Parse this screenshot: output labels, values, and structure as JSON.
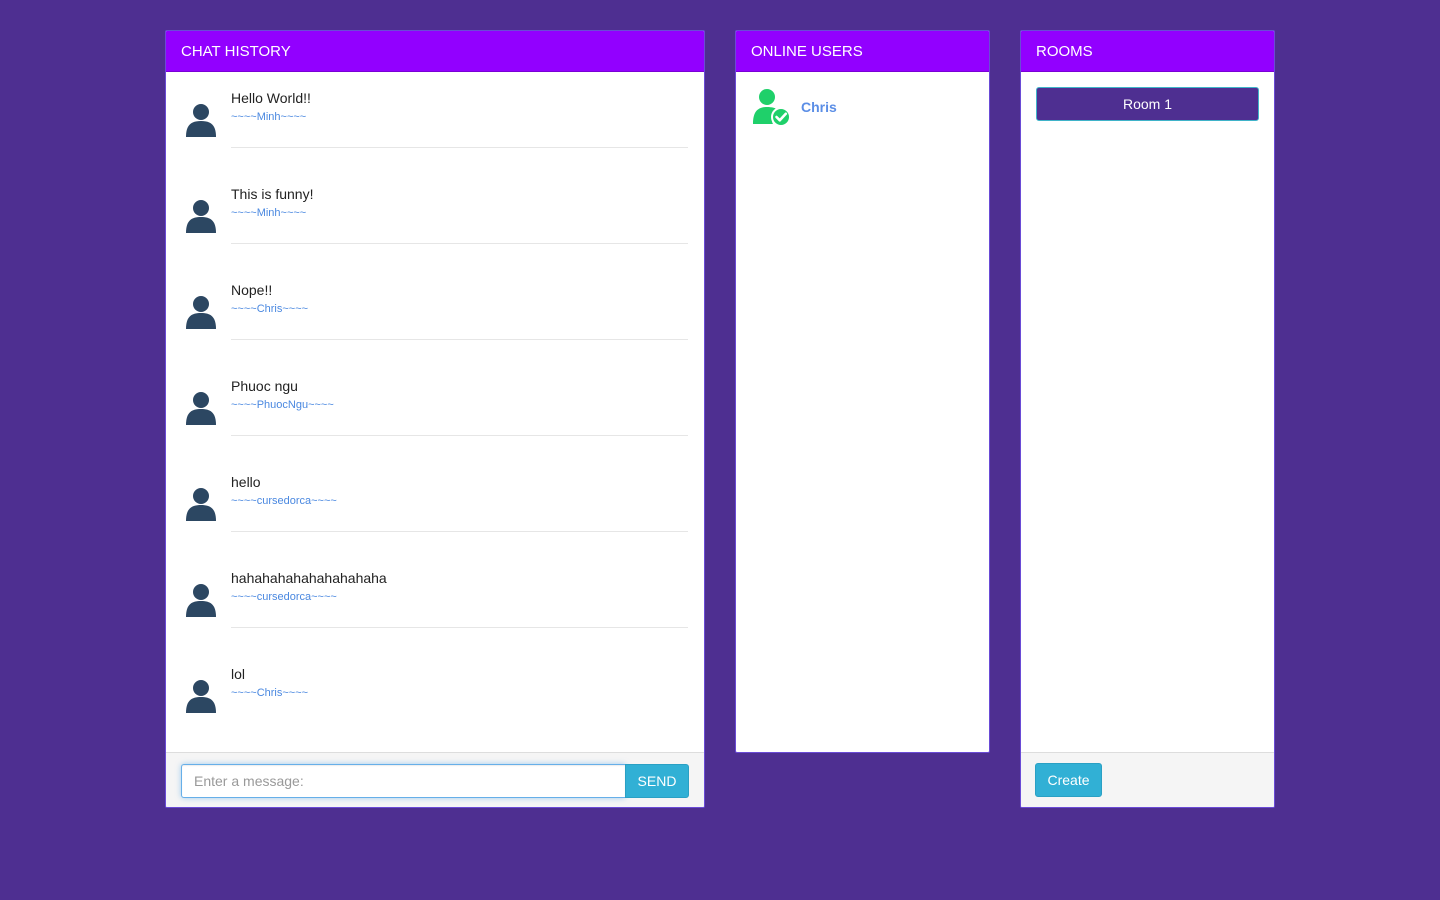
{
  "chat": {
    "title": "CHAT HISTORY",
    "messages": [
      {
        "text": "Hello World!!",
        "author": "~~~~Minh~~~~"
      },
      {
        "text": "This is funny!",
        "author": "~~~~Minh~~~~"
      },
      {
        "text": "Nope!!",
        "author": "~~~~Chris~~~~"
      },
      {
        "text": "Phuoc ngu",
        "author": "~~~~PhuocNgu~~~~"
      },
      {
        "text": "hello",
        "author": "~~~~cursedorca~~~~"
      },
      {
        "text": "hahahahahahahahahaha",
        "author": "~~~~cursedorca~~~~"
      },
      {
        "text": "lol",
        "author": "~~~~Chris~~~~"
      }
    ],
    "input_placeholder": "Enter a message:",
    "send_label": "SEND"
  },
  "users": {
    "title": "ONLINE USERS",
    "list": [
      {
        "name": "Chris",
        "icon": "online-user-icon"
      }
    ]
  },
  "rooms": {
    "title": "ROOMS",
    "list": [
      {
        "name": "Room 1"
      }
    ],
    "create_label": "Create"
  },
  "colors": {
    "background": "#4e2f91",
    "panel_heading": "#9200ff",
    "author_link": "#4a88e0",
    "accent_button": "#31b0d5",
    "online_green": "#1fd06a",
    "avatar": "#2c4762"
  }
}
